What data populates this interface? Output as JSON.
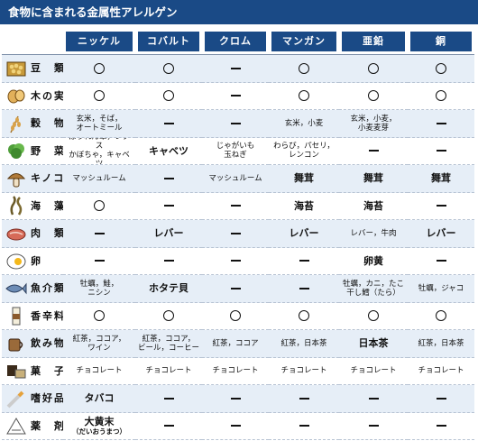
{
  "title": "食物に含まれる金属性アレルゲン",
  "metals": [
    "ニッケル",
    "コバルト",
    "クロム",
    "マンガン",
    "亜鉛",
    "銅"
  ],
  "rows": [
    {
      "name": "豆　類",
      "icon": "beans-icon",
      "cells": [
        "○",
        "○",
        "ー",
        "○",
        "○",
        "○"
      ]
    },
    {
      "name": "木の実",
      "icon": "nuts-icon",
      "cells": [
        "○",
        "○",
        "ー",
        "○",
        "○",
        "○"
      ]
    },
    {
      "name": "穀　物",
      "icon": "grain-icon",
      "cells": [
        "玄米，そば，\nオートミール",
        "ー",
        "ー",
        "玄米，小麦",
        "玄米，小麦，\n小麦麦芽",
        "ー"
      ]
    },
    {
      "name": "野　菜",
      "icon": "vegetable-icon",
      "cells": [
        "ほうれん草，レタス\nかぼちゃ，キャベツ",
        "キャベツ",
        "じゃがいも\n玉ねぎ",
        "わらび，パセリ，\nレンコン",
        "ー",
        "ー"
      ]
    },
    {
      "name": "キノコ",
      "icon": "mushroom-icon",
      "cells": [
        "マッシュルーム",
        "ー",
        "マッシュルーム",
        "舞茸",
        "舞茸",
        "舞茸"
      ]
    },
    {
      "name": "海　藻",
      "icon": "seaweed-icon",
      "cells": [
        "○",
        "ー",
        "ー",
        "海苔",
        "海苔",
        "ー"
      ]
    },
    {
      "name": "肉　類",
      "icon": "meat-icon",
      "cells": [
        "ー",
        "レバー",
        "ー",
        "レバー",
        "レバー，牛肉",
        "レバー"
      ]
    },
    {
      "name": "卵",
      "icon": "egg-icon",
      "cells": [
        "ー",
        "ー",
        "ー",
        "ー",
        "卵黄",
        "ー"
      ]
    },
    {
      "name": "魚介類",
      "icon": "fish-icon",
      "cells": [
        "牡蠣，鮭，\nニシン",
        "ホタテ貝",
        "ー",
        "ー",
        "牡蠣，カニ，たこ\n干し鱈（たら）",
        "牡蠣，ジャコ"
      ]
    },
    {
      "name": "香辛料",
      "icon": "spice-icon",
      "cells": [
        "○",
        "○",
        "○",
        "○",
        "○",
        "○"
      ]
    },
    {
      "name": "飲み物",
      "icon": "drink-icon",
      "cells": [
        "紅茶，ココア，\nワイン",
        "紅茶，ココア，\nビール，コーヒー",
        "紅茶，ココア",
        "紅茶，日本茶",
        "日本茶",
        "紅茶，日本茶"
      ]
    },
    {
      "name": "菓　子",
      "icon": "sweets-icon",
      "cells": [
        "チョコレート",
        "チョコレート",
        "チョコレート",
        "チョコレート",
        "チョコレート",
        "チョコレート"
      ]
    },
    {
      "name": "嗜好品",
      "icon": "cigarette-icon",
      "cells": [
        "タバコ",
        "ー",
        "ー",
        "ー",
        "ー",
        "ー"
      ]
    },
    {
      "name": "薬　剤",
      "icon": "medicine-icon",
      "cells": [
        "大黄末",
        "ー",
        "ー",
        "ー",
        "ー",
        "ー"
      ],
      "notes": [
        "（だいおうまつ）",
        "",
        "",
        "",
        "",
        ""
      ]
    }
  ],
  "colors": {
    "header": "#1a4a86",
    "shade": "#e6eef7"
  }
}
